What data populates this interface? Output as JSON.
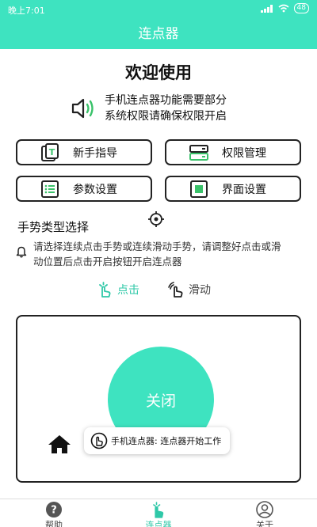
{
  "status_bar": {
    "time": "晚上7:01",
    "battery": "48"
  },
  "title_bar": {
    "title": "连点器"
  },
  "welcome": "欢迎使用",
  "notice": {
    "line1": "手机连点器功能需要部分",
    "line2": "系统权限请确保权限开启"
  },
  "buttons": {
    "guide": "新手指导",
    "permissions": "权限管理",
    "params": "参数设置",
    "interface": "界面设置"
  },
  "gesture": {
    "section_title": "手势类型选择",
    "hint": "请选择连续点击手势或连续滑动手势，请调整好点击或滑动位置后点击开启按钮开启连点器",
    "tap_label": "点击",
    "slide_label": "滑动"
  },
  "panel": {
    "toggle_label": "关闭"
  },
  "toast": {
    "text": "手机连点器: 连点器开始工作"
  },
  "bottom_nav": {
    "help": "帮助",
    "clicker": "连点器",
    "about": "关于"
  },
  "colors": {
    "accent": "#3ee3c0",
    "accent_text": "#2fc8a8",
    "border": "#222222"
  }
}
